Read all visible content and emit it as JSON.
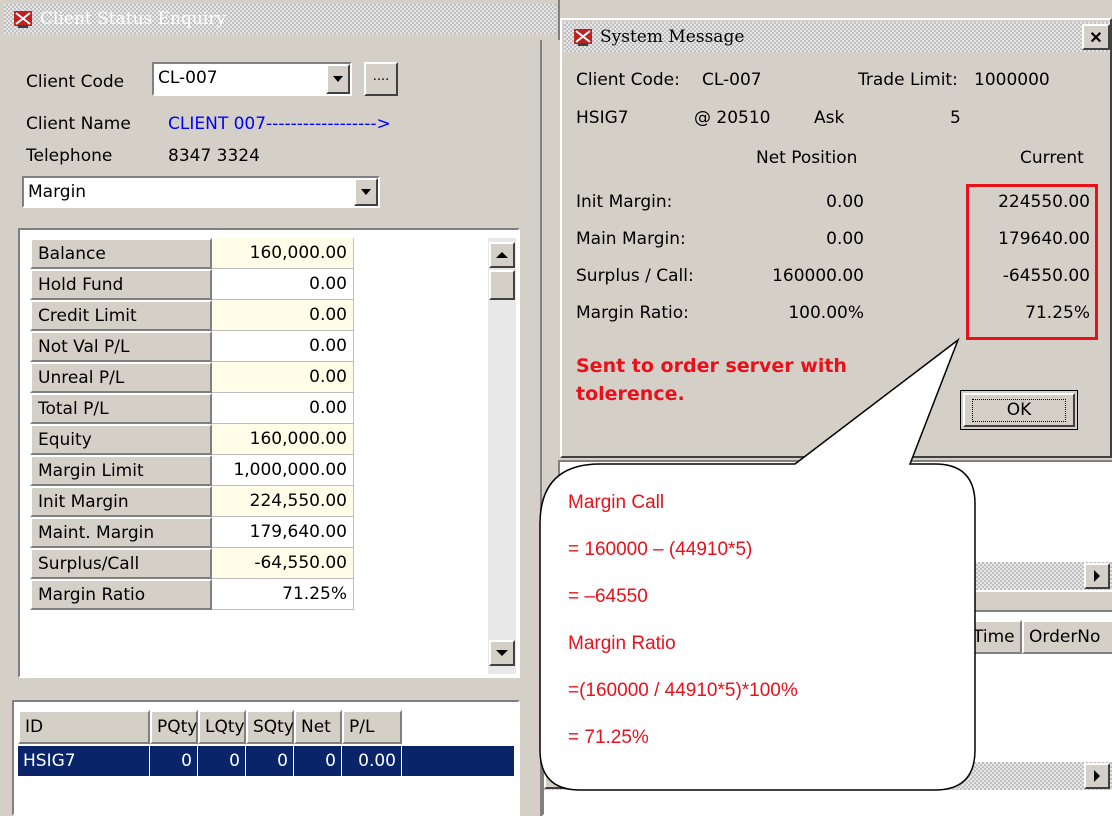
{
  "client_window": {
    "title": "Client Status Enquiry",
    "client_code_label": "Client Code",
    "client_code_value": "CL-007",
    "browse_label": "....",
    "client_name_label": "Client Name",
    "client_name_value": "CLIENT 007------------------>",
    "telephone_label": "Telephone",
    "telephone_value": "8347 3324",
    "view_select": "Margin",
    "rows": [
      {
        "label": "Balance",
        "value": "160,000.00"
      },
      {
        "label": "Hold Fund",
        "value": "0.00"
      },
      {
        "label": "Credit Limit",
        "value": "0.00"
      },
      {
        "label": "Not Val P/L",
        "value": "0.00"
      },
      {
        "label": "Unreal P/L",
        "value": "0.00"
      },
      {
        "label": "Total P/L",
        "value": "0.00"
      },
      {
        "label": "Equity",
        "value": "160,000.00"
      },
      {
        "label": "Margin Limit",
        "value": "1,000,000.00"
      },
      {
        "label": "Init Margin",
        "value": "224,550.00"
      },
      {
        "label": "Maint. Margin",
        "value": "179,640.00"
      },
      {
        "label": "Surplus/Call",
        "value": "-64,550.00"
      },
      {
        "label": "Margin Ratio",
        "value": "71.25%"
      }
    ],
    "positions": {
      "columns": [
        "ID",
        "PQty",
        "LQty",
        "SQty",
        "Net",
        "P/L"
      ],
      "rows": [
        [
          "HSIG7",
          "0",
          "0",
          "0",
          "0",
          "0.00"
        ]
      ]
    }
  },
  "right_pane": {
    "columns": [
      "Time",
      "OrderNo"
    ]
  },
  "system_message": {
    "title": "System Message",
    "client_code_label": "Client Code:",
    "client_code_value": "CL-007",
    "trade_limit_label": "Trade Limit:",
    "trade_limit_value": "1000000",
    "instrument": "HSIG7",
    "price": "@ 20510",
    "side": "Ask",
    "qty": "5",
    "col_net": "Net Position",
    "col_current": "Current",
    "rows": [
      {
        "label": "Init Margin:",
        "net": "0.00",
        "current": "224550.00"
      },
      {
        "label": "Main Margin:",
        "net": "0.00",
        "current": "179640.00"
      },
      {
        "label": "Surplus / Call:",
        "net": "160000.00",
        "current": "-64550.00"
      },
      {
        "label": "Margin Ratio:",
        "net": "100.00%",
        "current": "71.25%"
      }
    ],
    "warning_line1": "Sent to order server with",
    "warning_line2": "tolerence.",
    "ok_label": "OK",
    "close_label": "✕"
  },
  "callout": {
    "lines": [
      "Margin Call",
      "= 160000 – (44910*5)",
      "= –64550",
      "Margin Ratio",
      "=(160000 / 44910*5)*100%",
      "= 71.25%"
    ]
  },
  "colors": {
    "accent_red": "#e8101a",
    "selection_blue": "#0a246a",
    "field_yellow": "#fffde8",
    "link_blue": "#0000ff"
  }
}
